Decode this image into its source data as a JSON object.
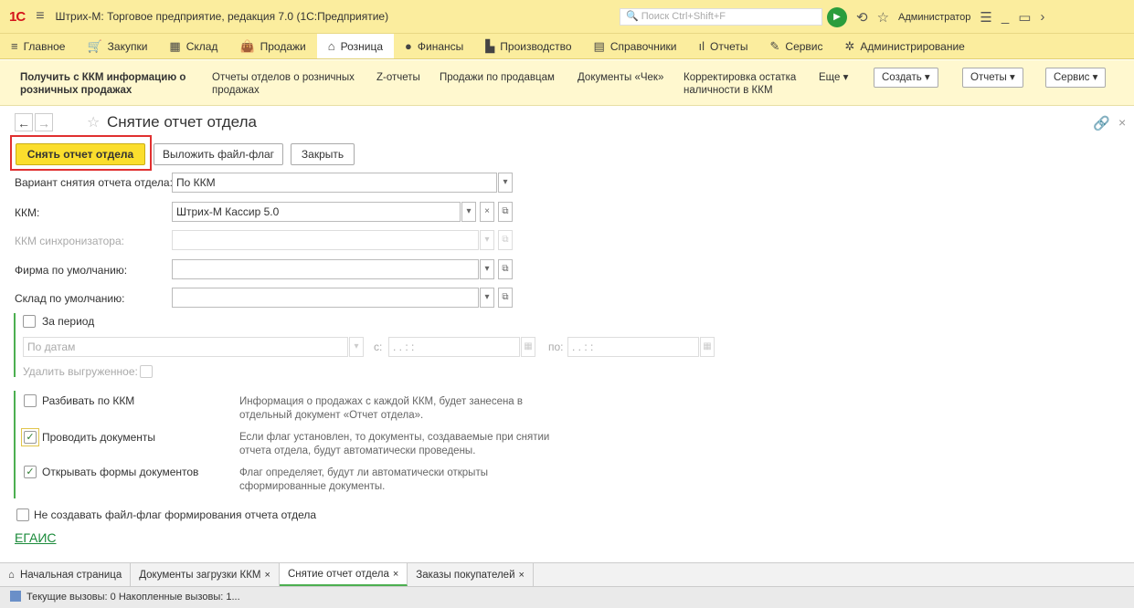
{
  "app": {
    "logo": "1С",
    "title": "Штрих-М: Торговое предприятие, редакция 7.0  (1С:Предприятие)",
    "search_placeholder": "Поиск Ctrl+Shift+F",
    "user": "Администратор"
  },
  "menu": [
    {
      "label": "Главное",
      "icon": "menu-lines-icon",
      "glyph": "≡"
    },
    {
      "label": "Закупки",
      "icon": "cart-icon",
      "glyph": "🛒"
    },
    {
      "label": "Склад",
      "icon": "warehouse-icon",
      "glyph": "▦"
    },
    {
      "label": "Продажи",
      "icon": "bag-icon",
      "glyph": "👜"
    },
    {
      "label": "Розница",
      "icon": "shop-icon",
      "glyph": "⌂"
    },
    {
      "label": "Финансы",
      "icon": "money-icon",
      "glyph": "●"
    },
    {
      "label": "Производство",
      "icon": "factory-icon",
      "glyph": "▙"
    },
    {
      "label": "Справочники",
      "icon": "book-icon",
      "glyph": "▤"
    },
    {
      "label": "Отчеты",
      "icon": "chart-icon",
      "glyph": "ıl"
    },
    {
      "label": "Сервис",
      "icon": "wrench-icon",
      "glyph": "✎"
    },
    {
      "label": "Администрирование",
      "icon": "gear-icon",
      "glyph": "✲"
    }
  ],
  "subnav": {
    "item1": "Получить с ККМ информацию о розничных продажах",
    "item2": "Отчеты отделов о розничных продажах",
    "item3": "Z-отчеты",
    "item4": "Продажи по продавцам",
    "item5": "Документы «Чек»",
    "item6": "Корректировка остатка наличности в ККМ",
    "more": "Еще ▾",
    "create": "Создать ▾",
    "reports": "Отчеты ▾",
    "service": "Сервис ▾"
  },
  "form": {
    "title": "Снятие отчет отдела",
    "btn_main": "Снять отчет отдела",
    "btn_flag": "Выложить файл-флаг",
    "btn_close": "Закрыть",
    "variant_label": "Вариант снятия отчета отдела:",
    "variant_value": "По ККМ",
    "kkm_label": "ККМ:",
    "kkm_value": "Штрих-М Кассир 5.0",
    "sync_label": "ККМ синхронизатора:",
    "firm_label": "Фирма по умолчанию:",
    "stock_label": "Склад по умолчанию:",
    "period_label": "За период",
    "by_dates": "По датам",
    "from_label": "с:",
    "to_label": "по:",
    "date_placeholder": " .  .     :  :",
    "delete_label": "Удалить выгруженное:",
    "split_label": "Разбивать по ККМ",
    "split_hint": "Информация о продажах с каждой ККМ, будет занесена в отдельный документ «Отчет отдела».",
    "post_label": "Проводить документы",
    "post_hint": "Если флаг установлен, то документы, создаваемые при снятии отчета отдела, будут автоматически проведены.",
    "open_label": "Открывать формы документов",
    "open_hint": "Флаг определяет, будут ли автоматически открыты сформированные документы.",
    "noflag_label": "Не создавать файл-флаг формирования отчета отдела",
    "egais": "ЕГАИС",
    "checks": {
      "period": false,
      "delete": false,
      "split": false,
      "post": true,
      "open": true,
      "noflag": false
    }
  },
  "tabs": [
    {
      "label": "Начальная страница",
      "closable": false
    },
    {
      "label": "Документы загрузки ККМ",
      "closable": true
    },
    {
      "label": "Снятие отчет отдела",
      "closable": true
    },
    {
      "label": "Заказы покупателей",
      "closable": true
    }
  ],
  "status": "Текущие вызовы: 0   Накопленные вызовы: 1...",
  "colors": {
    "accent_yellow": "#fbde2d",
    "header": "#fbed9e",
    "green": "#4caf50",
    "highlight_red": "#e03030"
  }
}
